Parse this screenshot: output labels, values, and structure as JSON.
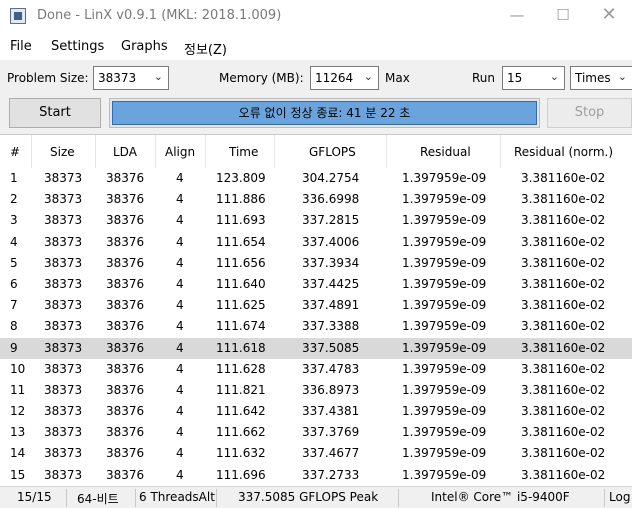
{
  "window": {
    "title": "Done - LinX v0.9.1 (MKL: 2018.1.009)"
  },
  "menu": [
    "File",
    "Settings",
    "Graphs",
    "정보(Z)"
  ],
  "toolbar": {
    "problem_size_label": "Problem Size:",
    "problem_size_value": "38373",
    "memory_label": "Memory (MB):",
    "memory_value": "11264",
    "max_label": "Max",
    "run_label": "Run",
    "run_value": "15",
    "run_unit": "Times"
  },
  "controls": {
    "start_label": "Start",
    "stop_label": "Stop",
    "status_text": "오류 없이 정상 종료: 41 분 22 초",
    "progress_fraction": 1.0
  },
  "table": {
    "headers": [
      "#",
      "Size",
      "LDA",
      "Align",
      "Time",
      "GFLOPS",
      "Residual",
      "Residual (norm.)"
    ],
    "selected_row": 8,
    "rows": [
      [
        "1",
        "38373",
        "38376",
        "4",
        "123.809",
        "304.2754",
        "1.397959e-09",
        "3.381160e-02"
      ],
      [
        "2",
        "38373",
        "38376",
        "4",
        "111.886",
        "336.6998",
        "1.397959e-09",
        "3.381160e-02"
      ],
      [
        "3",
        "38373",
        "38376",
        "4",
        "111.693",
        "337.2815",
        "1.397959e-09",
        "3.381160e-02"
      ],
      [
        "4",
        "38373",
        "38376",
        "4",
        "111.654",
        "337.4006",
        "1.397959e-09",
        "3.381160e-02"
      ],
      [
        "5",
        "38373",
        "38376",
        "4",
        "111.656",
        "337.3934",
        "1.397959e-09",
        "3.381160e-02"
      ],
      [
        "6",
        "38373",
        "38376",
        "4",
        "111.640",
        "337.4425",
        "1.397959e-09",
        "3.381160e-02"
      ],
      [
        "7",
        "38373",
        "38376",
        "4",
        "111.625",
        "337.4891",
        "1.397959e-09",
        "3.381160e-02"
      ],
      [
        "8",
        "38373",
        "38376",
        "4",
        "111.674",
        "337.3388",
        "1.397959e-09",
        "3.381160e-02"
      ],
      [
        "9",
        "38373",
        "38376",
        "4",
        "111.618",
        "337.5085",
        "1.397959e-09",
        "3.381160e-02"
      ],
      [
        "10",
        "38373",
        "38376",
        "4",
        "111.628",
        "337.4783",
        "1.397959e-09",
        "3.381160e-02"
      ],
      [
        "11",
        "38373",
        "38376",
        "4",
        "111.821",
        "336.8973",
        "1.397959e-09",
        "3.381160e-02"
      ],
      [
        "12",
        "38373",
        "38376",
        "4",
        "111.642",
        "337.4381",
        "1.397959e-09",
        "3.381160e-02"
      ],
      [
        "13",
        "38373",
        "38376",
        "4",
        "111.662",
        "337.3769",
        "1.397959e-09",
        "3.381160e-02"
      ],
      [
        "14",
        "38373",
        "38376",
        "4",
        "111.632",
        "337.4677",
        "1.397959e-09",
        "3.381160e-02"
      ],
      [
        "15",
        "38373",
        "38376",
        "4",
        "111.696",
        "337.2733",
        "1.397959e-09",
        "3.381160e-02"
      ]
    ]
  },
  "statusbar": {
    "progress": "15/15",
    "bits": "64-비트",
    "threads": "6 ThreadsAlt",
    "peak": "337.5085 GFLOPS Peak",
    "cpu": "Intel® Core™ i5-9400F",
    "log": "Log"
  },
  "colors": {
    "progress_fill": "#6ba4dc",
    "selected_row": "#d9d9d9"
  }
}
